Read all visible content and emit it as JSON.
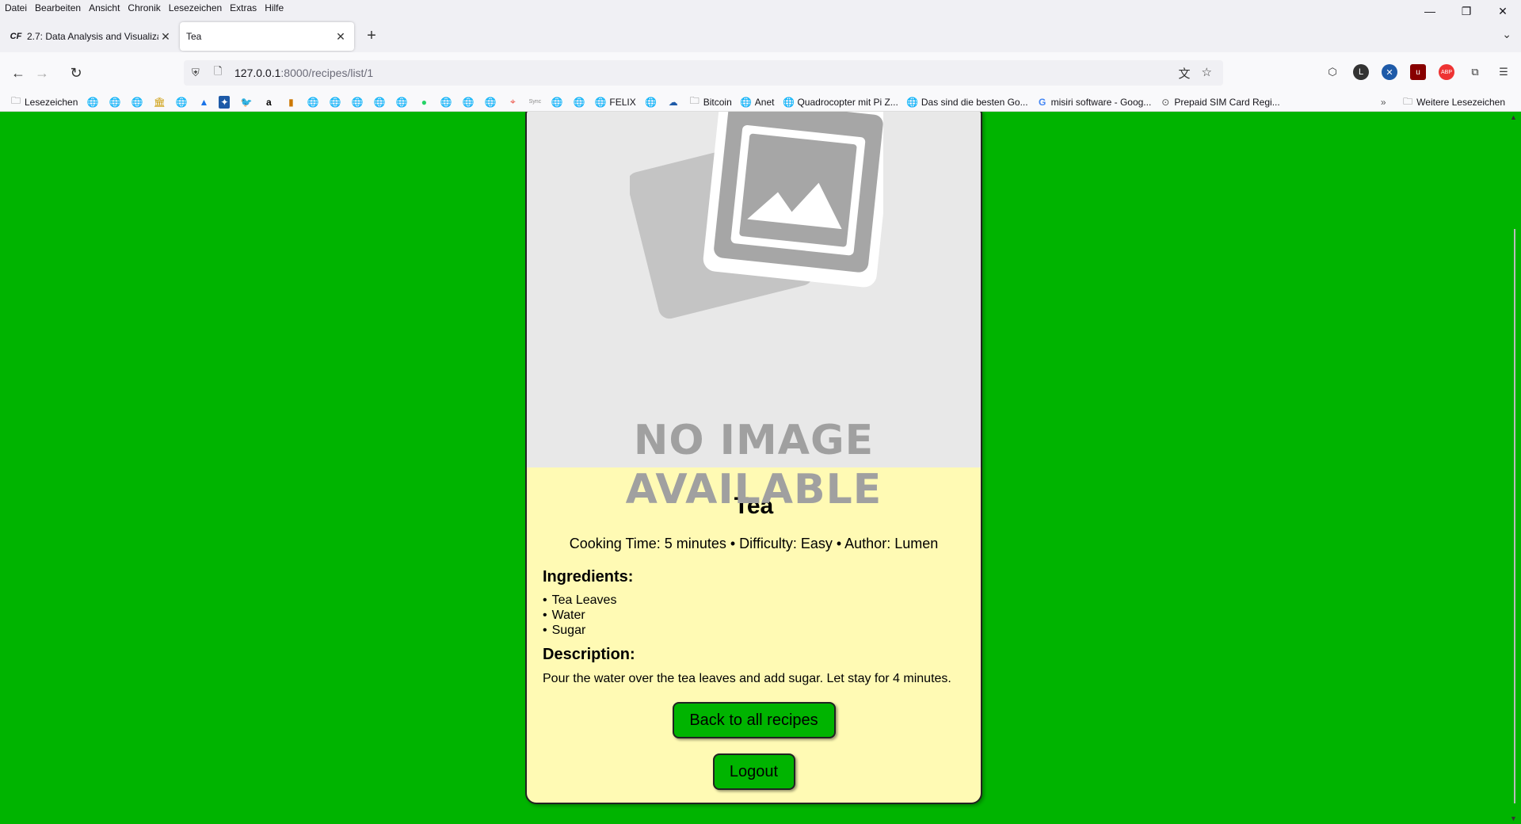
{
  "menubar": {
    "items": [
      "Datei",
      "Bearbeiten",
      "Ansicht",
      "Chronik",
      "Lesezeichen",
      "Extras",
      "Hilfe"
    ]
  },
  "tabs": [
    {
      "favicon": "CF",
      "title": "2.7: Data Analysis and Visualiza",
      "active": false
    },
    {
      "favicon": "",
      "title": "Tea",
      "active": true
    }
  ],
  "url": {
    "host": "127.0.0.1",
    "path": ":8000/recipes/list/1"
  },
  "bookmarks": {
    "items": [
      "Lesezeichen",
      "FELIX",
      "Bitcoin",
      "Anet",
      "Quadrocopter mit Pi Z...",
      "Das sind die besten Go...",
      "misiri software - Goog...",
      "Prepaid SIM Card Regi..."
    ],
    "more": "Weitere Lesezeichen",
    "sync_label": "Sync"
  },
  "recipe": {
    "image_text_line1": "NO IMAGE",
    "image_text_line2": "AVAILABLE",
    "title": "Tea",
    "meta": "Cooking Time: 5 minutes • Difficulty: Easy • Author: Lumen",
    "ingredients_heading": "Ingredients:",
    "ingredients": [
      "Tea Leaves",
      "Water",
      "Sugar"
    ],
    "description_heading": "Description:",
    "description": "Pour the water over the tea leaves and add sugar. Let stay for 4 minutes."
  },
  "buttons": {
    "back": "Back to all recipes",
    "logout": "Logout"
  },
  "colors": {
    "page_background": "#00b400",
    "card_background": "#fffab4",
    "button_green": "#00b400",
    "image_placeholder": "#e8e8e8"
  }
}
